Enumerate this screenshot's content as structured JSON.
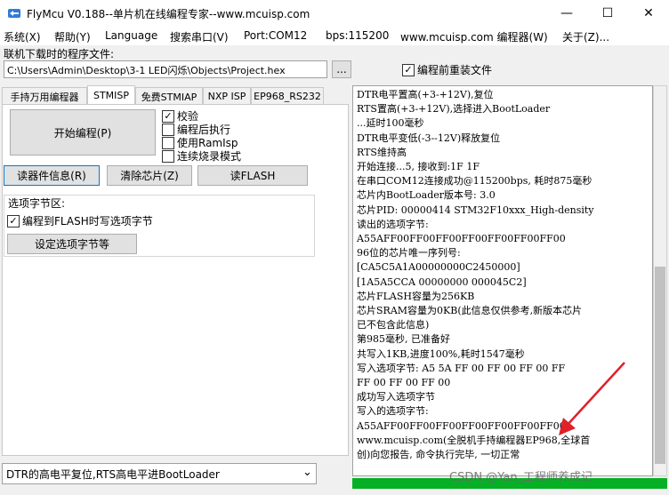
{
  "window": {
    "title": "FlyMcu V0.188--单片机在线编程专家--www.mcuisp.com",
    "minimize": "—",
    "maximize": "☐",
    "close": "✕"
  },
  "menu": [
    "系统(X)",
    "帮助(Y)",
    "Language",
    "搜索串口(V)",
    "Port:COM12",
    "bps:115200",
    "www.mcuisp.com 编程器(W)",
    "关于(Z)..."
  ],
  "file": {
    "label": "联机下载时的程序文件:",
    "path": "C:\\Users\\Admin\\Desktop\\3-1 LED闪烁\\Objects\\Project.hex",
    "browse": "...",
    "reload_label": "编程前重装文件",
    "reload_checked": "☑"
  },
  "tabs": [
    "手持万用编程器",
    "STMISP",
    "免费STMIAP",
    "NXP ISP",
    "EP968_RS232"
  ],
  "stmisp": {
    "start_button": "开始编程(P)",
    "options": [
      {
        "label": "校验",
        "mark": "✓"
      },
      {
        "label": "编程后执行",
        "mark": ""
      },
      {
        "label": "使用RamIsp",
        "mark": ""
      },
      {
        "label": "连续烧录模式",
        "mark": ""
      }
    ],
    "read_info": "读器件信息(R)",
    "erase_chip": "清除芯片(Z)",
    "read_flash": "读FLASH",
    "option_area_label": "选项字节区:",
    "write_option_label": "编程到FLASH时写选项字节",
    "write_option_mark": "✓",
    "set_option_button": "设定选项字节等"
  },
  "log_lines": [
    "DTR电平置高(+3-+12V),复位",
    "RTS置高(+3-+12V),选择进入BootLoader",
    "...延时100毫秒",
    "DTR电平变低(-3--12V)释放复位",
    "RTS维持高",
    "开始连接...5, 接收到:1F 1F",
    "在串口COM12连接成功@115200bps, 耗时875毫秒",
    "芯片内BootLoader版本号: 3.0",
    "芯片PID: 00000414   STM32F10xxx_High-density",
    "读出的选项字节:",
    "A55AFF00FF00FF00FF00FF00FF00FF00",
    "96位的芯片唯一序列号:",
    "[CA5C5A1A00000000C2450000]",
    "[1A5A5CCA 00000000 000045C2]",
    "芯片FLASH容量为256KB",
    "芯片SRAM容量为0KB(此信息仅供参考,新版本芯片",
    "已不包含此信息)",
    "第985毫秒, 已准备好",
    "共写入1KB,进度100%,耗时1547毫秒",
    "写入选项字节:  A5 5A FF 00 FF 00 FF 00 FF",
    "FF 00 FF 00 FF 00",
    "成功写入选项字节",
    "写入的选项字节:",
    "A55AFF00FF00FF00FF00FF00FF00FF00",
    "www.mcuisp.com(全脱机手持编程器EP968,全球首",
    "创)向您报告, 命令执行完毕, 一切正常"
  ],
  "bottom": {
    "reset_mode": "DTR的高电平复位,RTS高电平进BootLoader",
    "dropdown_arrow": "⌄"
  },
  "watermark": "CSDN @Yan_工程师养成记",
  "colors": {
    "progress": "#06b025",
    "arrow": "#e0202a"
  }
}
